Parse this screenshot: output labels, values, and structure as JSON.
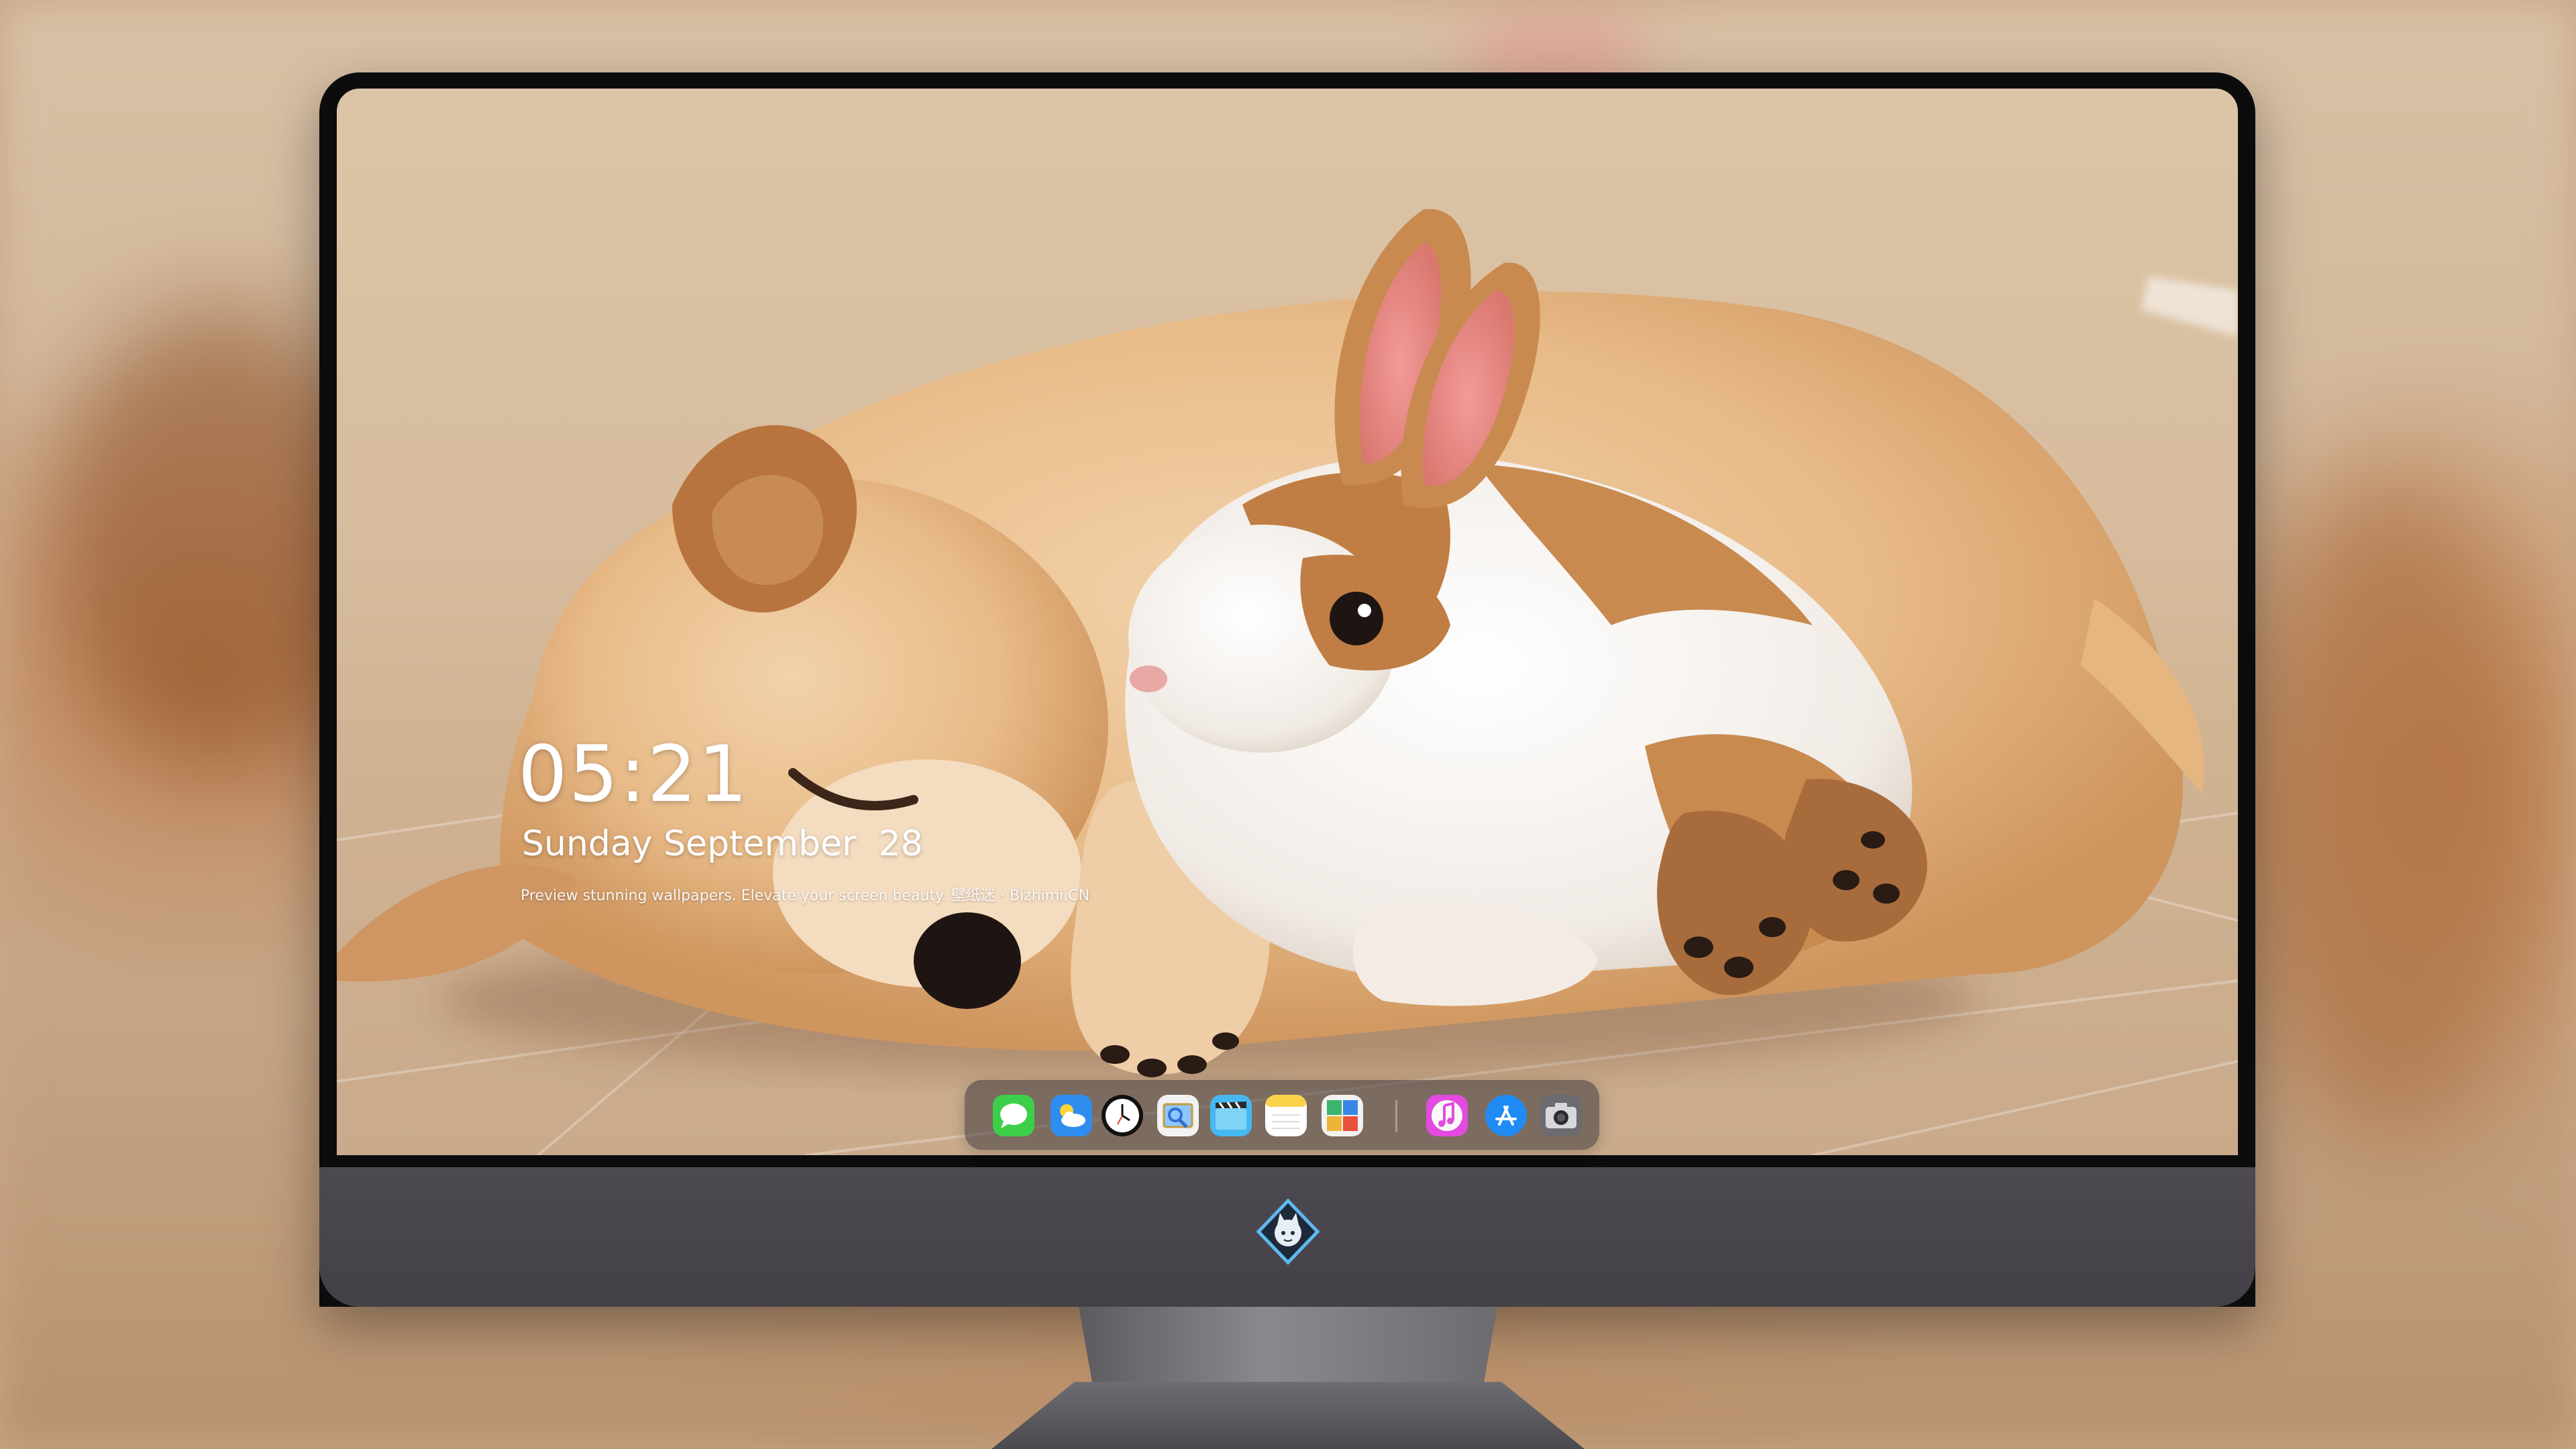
{
  "lock_screen": {
    "time": "05:21",
    "date": "Sunday September  28",
    "tagline": "Preview stunning wallpapers. Elevate your screen beauty. 壁纸迷 · Bizhimi.CN"
  },
  "dock": {
    "apps": [
      {
        "icon": "messages-icon",
        "color": "#3ecf4a"
      },
      {
        "icon": "weather-icon",
        "color": "#2f8df0"
      },
      {
        "icon": "clock-icon",
        "color": "#111111"
      },
      {
        "icon": "preview-icon",
        "color": "#f2f2f2"
      },
      {
        "icon": "clips-icon",
        "color": "#45b8f0"
      },
      {
        "icon": "notes-icon",
        "color": "#f9d44a"
      },
      {
        "icon": "photo-booth-icon",
        "color": "#f2f2f2"
      },
      {
        "icon": "music-icon",
        "color": "#e24ae0"
      },
      {
        "icon": "app-store-icon",
        "color": "#1f8bf5"
      },
      {
        "icon": "camera-icon",
        "color": "#6b6b70"
      }
    ]
  },
  "monitor": {
    "chin_logo_icon": "anime-avatar-logo-icon",
    "frame_color": "#0c0c0d",
    "chin_color": "#48464c"
  }
}
